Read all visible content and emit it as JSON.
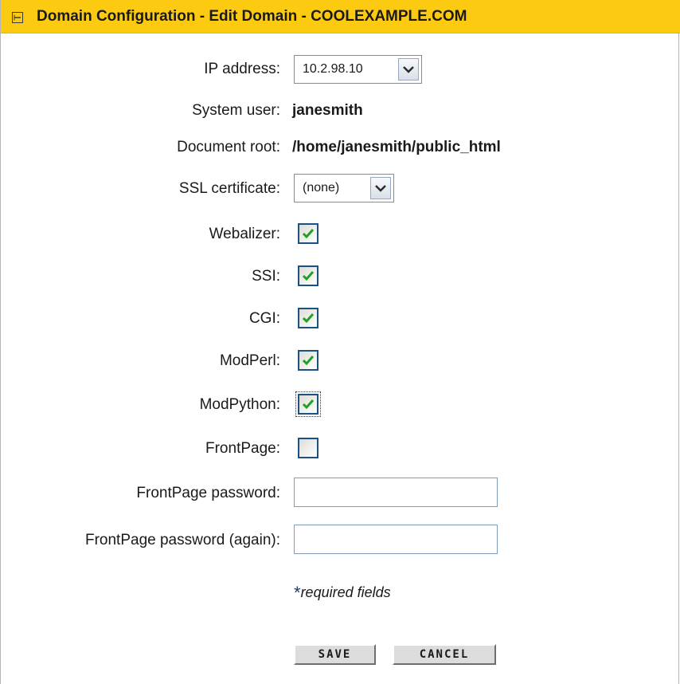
{
  "header": {
    "title": "Domain Configuration - Edit Domain - COOLEXAMPLE.COM",
    "collapse_icon": "collapse-minus-icon",
    "background_color": "#fccb11"
  },
  "form": {
    "ip_address": {
      "label": "IP address:",
      "selected": "10.2.98.10"
    },
    "system_user": {
      "label": "System user:",
      "value": "janesmith"
    },
    "document_root": {
      "label": "Document root:",
      "value": "/home/janesmith/public_html"
    },
    "ssl_certificate": {
      "label": "SSL certificate:",
      "selected": "(none)"
    },
    "checkboxes": [
      {
        "label": "Webalizer:",
        "checked": true
      },
      {
        "label": "SSI:",
        "checked": true
      },
      {
        "label": "CGI:",
        "checked": true
      },
      {
        "label": "ModPerl:",
        "checked": true
      },
      {
        "label": "ModPython:",
        "checked": true,
        "focused": true
      },
      {
        "label": "FrontPage:",
        "checked": false
      }
    ],
    "frontpage_password": {
      "label": "FrontPage password:",
      "value": ""
    },
    "frontpage_password_again": {
      "label": "FrontPage password (again):",
      "value": ""
    },
    "required_note": {
      "marker": "*",
      "text": "required fields"
    }
  },
  "actions": {
    "save_label": "SAVE",
    "cancel_label": "CANCEL"
  },
  "colors": {
    "checkmark": "#21a121",
    "checkbox_border": "#1c5180"
  }
}
